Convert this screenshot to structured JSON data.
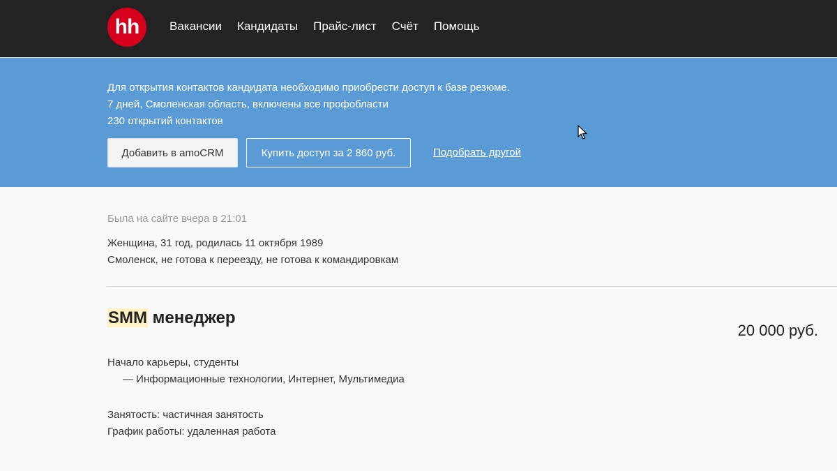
{
  "header": {
    "logo_text": "hh",
    "nav": [
      "Вакансии",
      "Кандидаты",
      "Прайс-лист",
      "Счёт",
      "Помощь"
    ]
  },
  "banner": {
    "line1": "Для открытия контактов кандидата необходимо приобрести доступ к базе резюме.",
    "line2": "7 дней, Смоленская область, включены все профобласти",
    "line3": "230 открытий контактов",
    "add_amocrm_label": "Добавить в amoCRM",
    "buy_access_label": "Купить доступ за 2 860 руб.",
    "choose_other_label": "Подобрать другой"
  },
  "resume": {
    "last_seen": "Была на сайте вчера в 21:01",
    "personal_line1": "Женщина, 31 год, родилась 11 октября 1989",
    "personal_line2": "Смоленск, не готова к переезду, не готова к командировкам",
    "title_highlight": "SMM",
    "title_rest": " менеджер",
    "salary": "20 000 руб.",
    "spec_main": "Начало карьеры, студенты",
    "spec_sub": "— Информационные технологии, Интернет, Мультимедиа",
    "employment": "Занятость: частичная занятость",
    "schedule": "График работы: удаленная работа"
  },
  "colors": {
    "topbar": "#232323",
    "logo": "#d6001c",
    "banner": "#5a9bd6",
    "highlight": "#fff3c4"
  },
  "icons": {
    "cursor": "mouse-pointer-icon"
  }
}
